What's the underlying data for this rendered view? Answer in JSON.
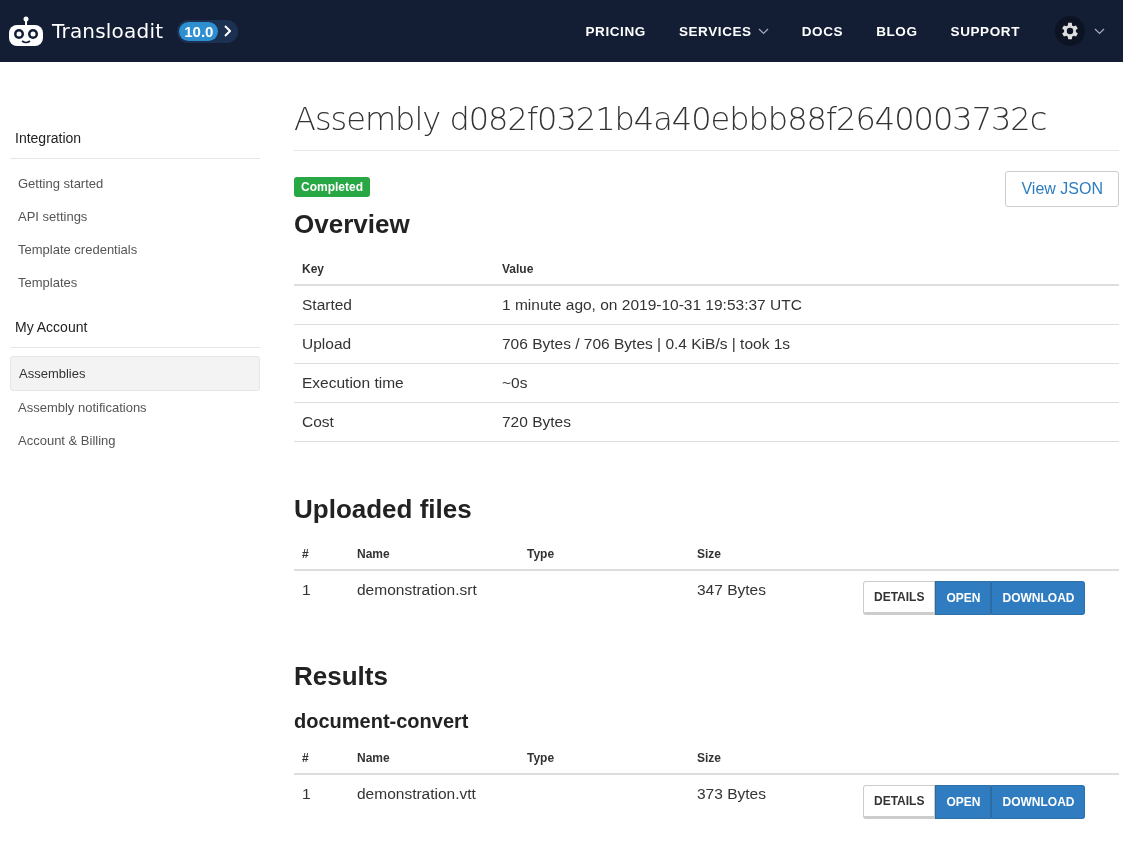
{
  "header": {
    "brand": "Transloadit",
    "version": "10.0",
    "nav": [
      {
        "label": "PRICING",
        "dropdown": false
      },
      {
        "label": "SERVICES",
        "dropdown": true
      },
      {
        "label": "DOCS",
        "dropdown": false
      },
      {
        "label": "BLOG",
        "dropdown": false
      },
      {
        "label": "SUPPORT",
        "dropdown": false
      }
    ]
  },
  "sidebar": {
    "sections": [
      {
        "title": "Integration",
        "items": [
          {
            "label": "Getting started",
            "selected": false
          },
          {
            "label": "API settings",
            "selected": false
          },
          {
            "label": "Template credentials",
            "selected": false
          },
          {
            "label": "Templates",
            "selected": false
          }
        ]
      },
      {
        "title": "My Account",
        "items": [
          {
            "label": "Assemblies",
            "selected": true
          },
          {
            "label": "Assembly notifications",
            "selected": false
          },
          {
            "label": "Account & Billing",
            "selected": false
          }
        ]
      }
    ]
  },
  "main": {
    "title": "Assembly d082f0321b4a40ebbb88f2640003732c",
    "status": "Completed",
    "view_json": "View JSON",
    "overview": {
      "heading": "Overview",
      "columns": [
        "Key",
        "Value"
      ],
      "rows": [
        [
          "Started",
          "1 minute ago, on 2019-10-31 19:53:37 UTC"
        ],
        [
          "Upload",
          "706 Bytes / 706 Bytes | 0.4 KiB/s | took 1s"
        ],
        [
          "Execution time",
          "~0s"
        ],
        [
          "Cost",
          "720 Bytes"
        ]
      ]
    },
    "uploaded": {
      "heading": "Uploaded files",
      "columns": [
        "#",
        "Name",
        "Type",
        "Size"
      ],
      "rows": [
        {
          "cells": [
            "1",
            "demonstration.srt",
            "",
            "347 Bytes"
          ],
          "buttons": [
            "DETAILS",
            "OPEN",
            "DOWNLOAD"
          ]
        }
      ]
    },
    "results": {
      "heading": "Results",
      "steps": [
        {
          "name": "document-convert",
          "columns": [
            "#",
            "Name",
            "Type",
            "Size"
          ],
          "rows": [
            {
              "cells": [
                "1",
                "demonstration.vtt",
                "",
                "373 Bytes"
              ],
              "buttons": [
                "DETAILS",
                "OPEN",
                "DOWNLOAD"
              ]
            }
          ]
        }
      ]
    }
  }
}
